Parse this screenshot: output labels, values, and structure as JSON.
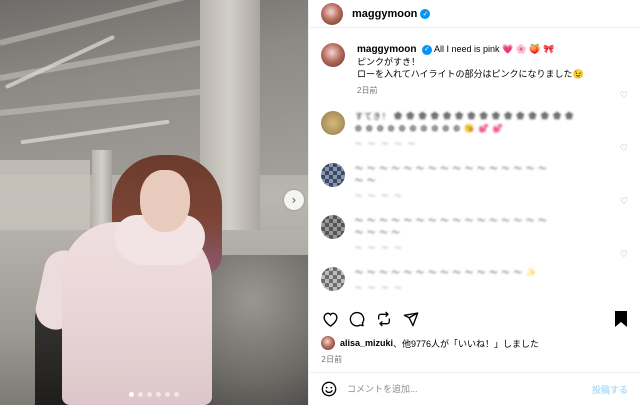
{
  "header": {
    "username": "maggymoon",
    "verified_icon": "verified-badge-icon"
  },
  "caption": {
    "username": "maggymoon",
    "line1": "All I need is pink 💗 🌸 🍑 🎀",
    "line2": "ピンクがすき！",
    "line3": "ローを入れてハイライトの部分はピンクになりました😉",
    "time": "2日前"
  },
  "comments": [
    {
      "text_line1": "すてき！ ✿ ✿ ✿ ✿ ✿ ✿ ✿ ✿ ✿ ✿ ✿ ✿ ✿ ✿ ✿",
      "text_line2": "✿ ✿ ✿ ✿ ✿ ✿ ✿ ✿ ✿ ✿ 😘 💕 💕",
      "meta": "〜 〜 〜 〜 〜"
    },
    {
      "text_line1": "〜 〜 〜 〜 〜 〜 〜 〜 〜 〜 〜 〜 〜 〜 〜 〜",
      "text_line2": "〜 〜",
      "meta": "〜 〜 〜 〜"
    },
    {
      "text_line1": "〜 〜 〜 〜 〜 〜 〜 〜 〜 〜 〜 〜 〜 〜 〜 〜",
      "text_line2": "〜 〜 〜 〜",
      "meta": "〜 〜 〜 〜"
    },
    {
      "text_line1": "〜 〜 〜 〜 〜 〜 〜 〜 〜 〜 〜 〜 〜 〜 ✨",
      "text_line2": "",
      "meta": "〜 〜 〜 〜"
    }
  ],
  "likes": {
    "user": "alisa_mizuki",
    "rest": "、他9776人が「いいね！」しました"
  },
  "post_date": "2日前",
  "add_comment": {
    "placeholder": "コメントを追加...",
    "post_label": "投稿する"
  },
  "carousel": {
    "total": 6,
    "current": 1
  },
  "colors": {
    "accent": "#0095f6",
    "post_button": "#b2dffc",
    "muted_text": "#737373"
  },
  "icons": [
    "chevron-right-icon",
    "heart-icon",
    "comment-icon",
    "share-icon",
    "bookmark-icon",
    "emoji-icon",
    "verified-badge-icon"
  ]
}
